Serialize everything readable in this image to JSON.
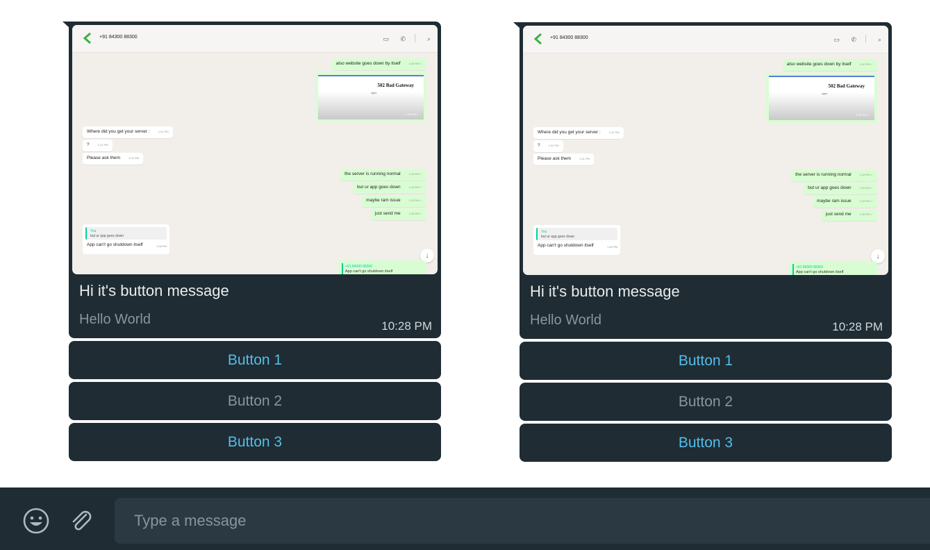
{
  "message": {
    "title": "Hi it's button message",
    "subtitle": "Hello World",
    "time": "10:28 PM",
    "buttons": [
      "Button 1",
      "Button 2",
      "Button 3"
    ]
  },
  "screenshot": {
    "phone": "+91 84300 88300",
    "bubbles": {
      "b0": "also website goes down by itself",
      "b0t": "1:30 PM ✓",
      "gw_title": "502 Bad Gateway",
      "gw_sub": "nginx",
      "gw_time": "1:30 PM ✓",
      "b1": "Where did you get your server :",
      "b1t": "1:31 PM",
      "b2": "?",
      "b2t": "1:31 PM",
      "b3": "Please ask them",
      "b3t": "1:31 PM",
      "b4": "the server is running normal",
      "b4t": "1:33 PM ✓",
      "b5": "but ur app goes down",
      "b5t": "1:33 PM ✓",
      "b6": "maybe ram issue",
      "b6t": "1:33 PM ✓",
      "b7": "just send me",
      "b7t": "1:36 PM ✓",
      "q_you": "You",
      "q_quoted": "but ur app goes down",
      "q_msg": "App can't go shutdown itself",
      "q_time": "1:36 PM",
      "f_name": "+91 84300 88300",
      "f_msg": "App can't go shutdown itself"
    }
  },
  "composer": {
    "placeholder": "Type a message"
  },
  "icons": {
    "emoji": "emoji-icon",
    "attach": "paperclip-icon"
  },
  "colors": {
    "panel": "#1f2c33",
    "input": "#2a3942",
    "button_active": "#53bdeb",
    "button_dim": "#8696a0"
  }
}
